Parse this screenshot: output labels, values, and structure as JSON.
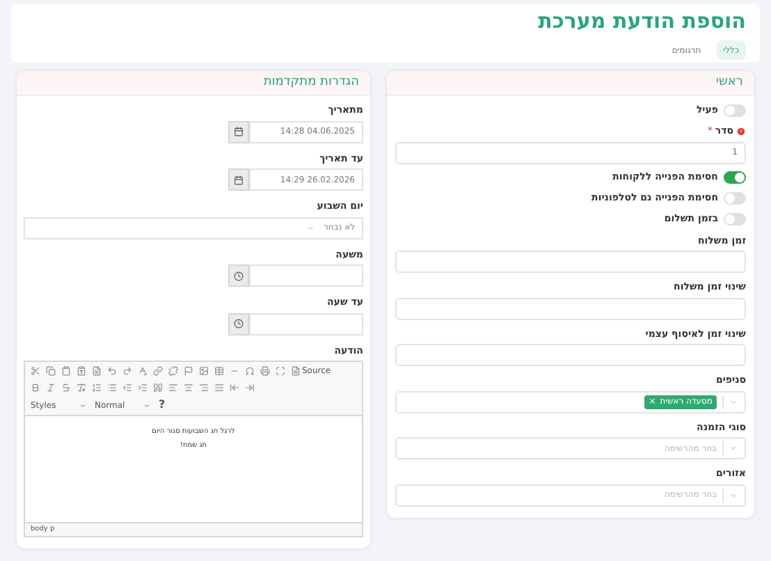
{
  "page": {
    "title": "הוספת הודעת מערכת"
  },
  "tabs": [
    {
      "label": "כללי",
      "selected": true
    },
    {
      "label": "תרגומים",
      "selected": false
    }
  ],
  "main_card": {
    "title": "ראשי",
    "fields": [
      {
        "kind": "toggle",
        "label": "פעיל",
        "on": false
      },
      {
        "kind": "input",
        "label": "סדר",
        "required_mark": "*",
        "value": "1"
      },
      {
        "kind": "toggle",
        "label": "חסימת הפנייה ללקוחות",
        "on": true
      },
      {
        "kind": "toggle",
        "label": "חסימת הפנייה גם לטלפוניות",
        "on": false
      },
      {
        "kind": "toggle",
        "label": "בזמן תשלום",
        "on": false
      },
      {
        "kind": "input",
        "label": "זמן משלוח"
      },
      {
        "kind": "input",
        "label": "שינוי זמן משלוח"
      },
      {
        "kind": "input",
        "label": "שינוי זמן לאיסוף עצמי"
      },
      {
        "kind": "multiselect",
        "label": "סניפים",
        "tags": [
          {
            "label": "מסעדה ראשית",
            "remove": "×"
          }
        ]
      },
      {
        "kind": "multiselect",
        "label": "סוגי הזמנה",
        "placeholder": "בחר מהרשימה"
      },
      {
        "kind": "multiselect",
        "label": "אזורים",
        "placeholder": "בחר מהרשימה"
      }
    ]
  },
  "advanced_card": {
    "title": "הגדרות מתקדמות",
    "fields": [
      {
        "kind": "date",
        "label": "מתאריך",
        "value": "04.06.2025 14:28"
      },
      {
        "kind": "date",
        "label": "עד תאריך",
        "value": "26.02.2026 14:29"
      },
      {
        "kind": "select",
        "label": "יום השבוע",
        "value": "לא נבחר"
      },
      {
        "kind": "time",
        "label": "משעה"
      },
      {
        "kind": "time",
        "label": "עד שעה"
      },
      {
        "kind": "editor",
        "label": "הודעה",
        "toolbar": {
          "source": "Source",
          "styles": "Styles",
          "format": "Normal",
          "help": "?"
        },
        "content": [
          "לרגל חג השבועות סגור היום",
          "חג שמח!"
        ],
        "path": "body p"
      }
    ]
  }
}
